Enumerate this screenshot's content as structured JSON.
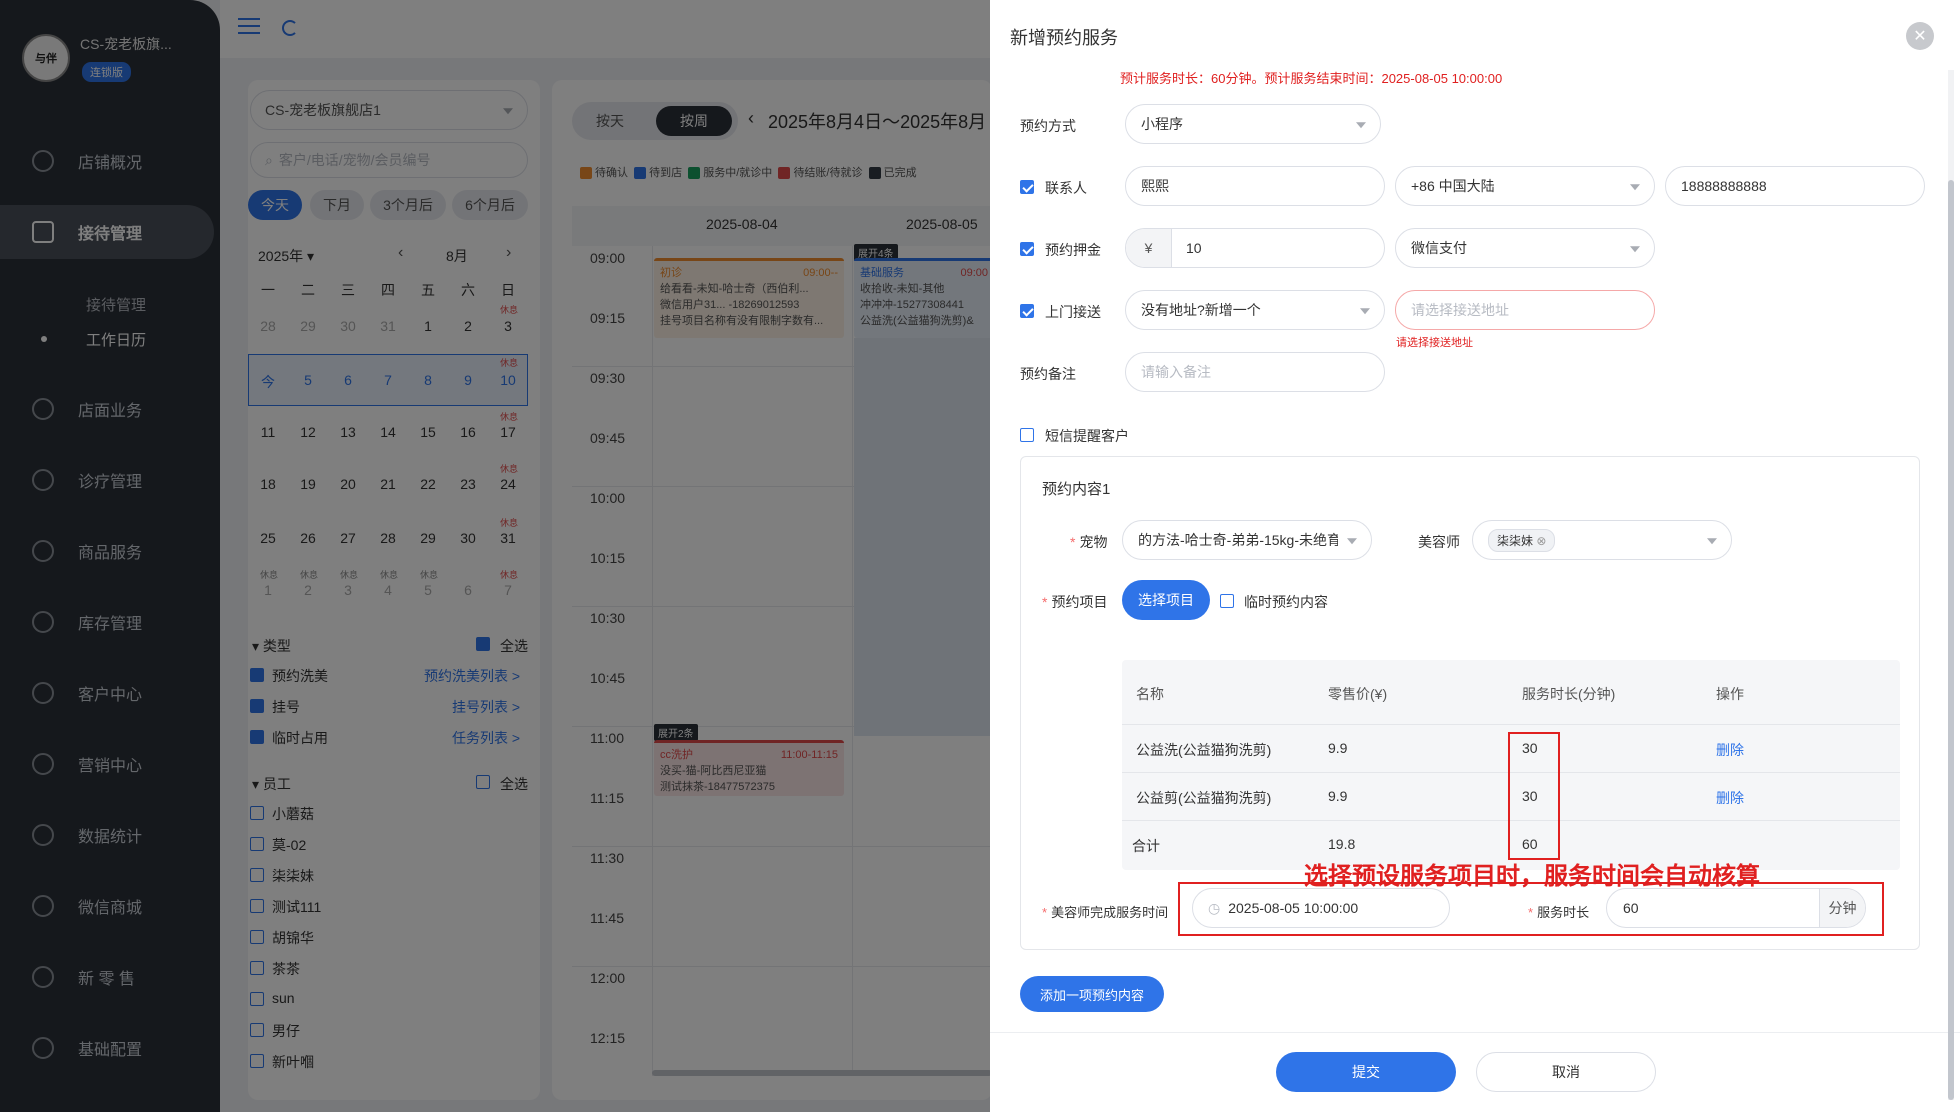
{
  "sidebar": {
    "avatar_text": "与伴",
    "store_name": "CS-宠老板旗...",
    "badge": "连锁版",
    "items": [
      {
        "label": "店铺概况",
        "icon": "dashboard-icon"
      },
      {
        "label": "接待管理",
        "icon": "reception-icon"
      },
      {
        "label": "店面业务",
        "icon": "store-icon"
      },
      {
        "label": "诊疗管理",
        "icon": "medical-icon"
      },
      {
        "label": "商品服务",
        "icon": "goods-icon"
      },
      {
        "label": "库存管理",
        "icon": "inventory-icon"
      },
      {
        "label": "客户中心",
        "icon": "customer-icon"
      },
      {
        "label": "营销中心",
        "icon": "marketing-icon"
      },
      {
        "label": "数据统计",
        "icon": "stats-icon"
      },
      {
        "label": "微信商城",
        "icon": "wechat-mall-icon"
      },
      {
        "label": "新 零 售",
        "icon": "retail-icon"
      },
      {
        "label": "基础配置",
        "icon": "settings-icon"
      }
    ],
    "sub_items": [
      "接待管理",
      "工作日历"
    ]
  },
  "filter": {
    "store_select": "CS-宠老板旗舰店1",
    "search_placeholder": "客户/电话/宠物/会员编号",
    "quick": [
      "今天",
      "下月",
      "3个月后",
      "6个月后"
    ],
    "year": "2025年",
    "month": "8月",
    "weekdays": [
      "一",
      "二",
      "三",
      "四",
      "五",
      "六",
      "日"
    ],
    "rows": [
      [
        "28",
        "29",
        "30",
        "31",
        "1",
        "2",
        "3"
      ],
      [
        "今",
        "5",
        "6",
        "7",
        "8",
        "9",
        "10"
      ],
      [
        "11",
        "12",
        "13",
        "14",
        "15",
        "16",
        "17"
      ],
      [
        "18",
        "19",
        "20",
        "21",
        "22",
        "23",
        "24"
      ],
      [
        "25",
        "26",
        "27",
        "28",
        "29",
        "30",
        "31"
      ],
      [
        "1",
        "2",
        "3",
        "4",
        "5",
        "6",
        "7"
      ]
    ],
    "rest_label": "休息",
    "type_title": "类型",
    "all_label": "全选",
    "types": [
      {
        "label": "预约洗美",
        "link": "预约洗美列表 >"
      },
      {
        "label": "挂号",
        "link": "挂号列表 >"
      },
      {
        "label": "临时占用",
        "link": "任务列表 >"
      }
    ],
    "staff_title": "员工",
    "staff": [
      "小蘑菇",
      "莫-02",
      "柒柒妹",
      "测试111",
      "胡锦华",
      "茶茶",
      "sun",
      "男仔",
      "新叶嗰"
    ]
  },
  "calendar": {
    "tab_day": "按天",
    "tab_week": "按周",
    "title": "2025年8月4日～2025年8月",
    "legend": [
      {
        "label": "待确认",
        "color": "#f08c2e"
      },
      {
        "label": "待到店",
        "color": "#2f74e8"
      },
      {
        "label": "服务中/就诊中",
        "color": "#19a15f"
      },
      {
        "label": "待结账/待就诊",
        "color": "#e04b4b"
      },
      {
        "label": "已完成",
        "color": "#333a44"
      }
    ],
    "days": [
      "2025-08-04",
      "2025-08-05"
    ],
    "times": [
      "09:00",
      "09:15",
      "09:30",
      "09:45",
      "10:00",
      "10:15",
      "10:30",
      "10:45",
      "11:00",
      "11:15",
      "11:30",
      "11:45",
      "12:00",
      "12:15"
    ],
    "events": [
      {
        "tag": "",
        "title": "初诊",
        "time": "09:00--",
        "lines": [
          "给看看-未知-哈士奇（西伯利...",
          "微信用户31... -18269012593",
          "挂号项目名称有没有限制字数有..."
        ]
      },
      {
        "tag": "展开4条",
        "title": "基础服务",
        "time": "09:00",
        "lines": [
          "收拾收-未知-其他",
          "冲冲冲-15277308441",
          "公益洗(公益猫狗洗剪)&"
        ]
      },
      {
        "tag": "展开2条",
        "title": "cc洗护",
        "time": "11:00-11:15",
        "lines": [
          "没买-猫-阿比西尼亚猫",
          "测试抹茶-18477572375"
        ]
      }
    ]
  },
  "drawer": {
    "title": "新增预约服务",
    "notice": "预计服务时长：60分钟。预计服务结束时间：2025-08-05 10:00:00",
    "method_label": "预约方式",
    "method_value": "小程序",
    "contact_label": "联系人",
    "contact_name": "熙熙",
    "contact_region": "+86 中国大陆",
    "contact_phone": "18888888888",
    "deposit_label": "预约押金",
    "currency": "¥",
    "deposit_value": "10",
    "payment": "微信支付",
    "pickup_label": "上门接送",
    "pickup_value": "没有地址?新增一个",
    "pickup_addr_placeholder": "请选择接送地址",
    "pickup_error": "请选择接送地址",
    "remark_label": "预约备注",
    "remark_placeholder": "请输入备注",
    "sms_label": "短信提醒客户",
    "content_title": "预约内容1",
    "pet_label": "宠物",
    "pet_value": "的方法-哈士奇-弟弟-15kg-未绝育",
    "groomer_label": "美容师",
    "groomer_tag": "柒柒妹",
    "project_label": "预约项目",
    "select_project": "选择项目",
    "temp_label": "临时预约内容",
    "table_headers": [
      "名称",
      "零售价(¥)",
      "服务时长(分钟)",
      "操作"
    ],
    "table_rows": [
      {
        "name": "公益洗(公益猫狗洗剪)",
        "price": "9.9",
        "duration": "30",
        "op": "删除"
      },
      {
        "name": "公益剪(公益猫狗洗剪)",
        "price": "9.9",
        "duration": "30",
        "op": "删除"
      }
    ],
    "total_label": "合计",
    "total_price": "19.8",
    "total_duration": "60",
    "finish_label": "美容师完成服务时间",
    "finish_value": "2025-08-05 10:00:00",
    "duration_label": "服务时长",
    "duration_value": "60",
    "duration_unit": "分钟",
    "add_content": "添加一项预约内容",
    "submit": "提交",
    "cancel": "取消",
    "annotation": "选择预设服务项目时，服务时间会自动核算"
  }
}
